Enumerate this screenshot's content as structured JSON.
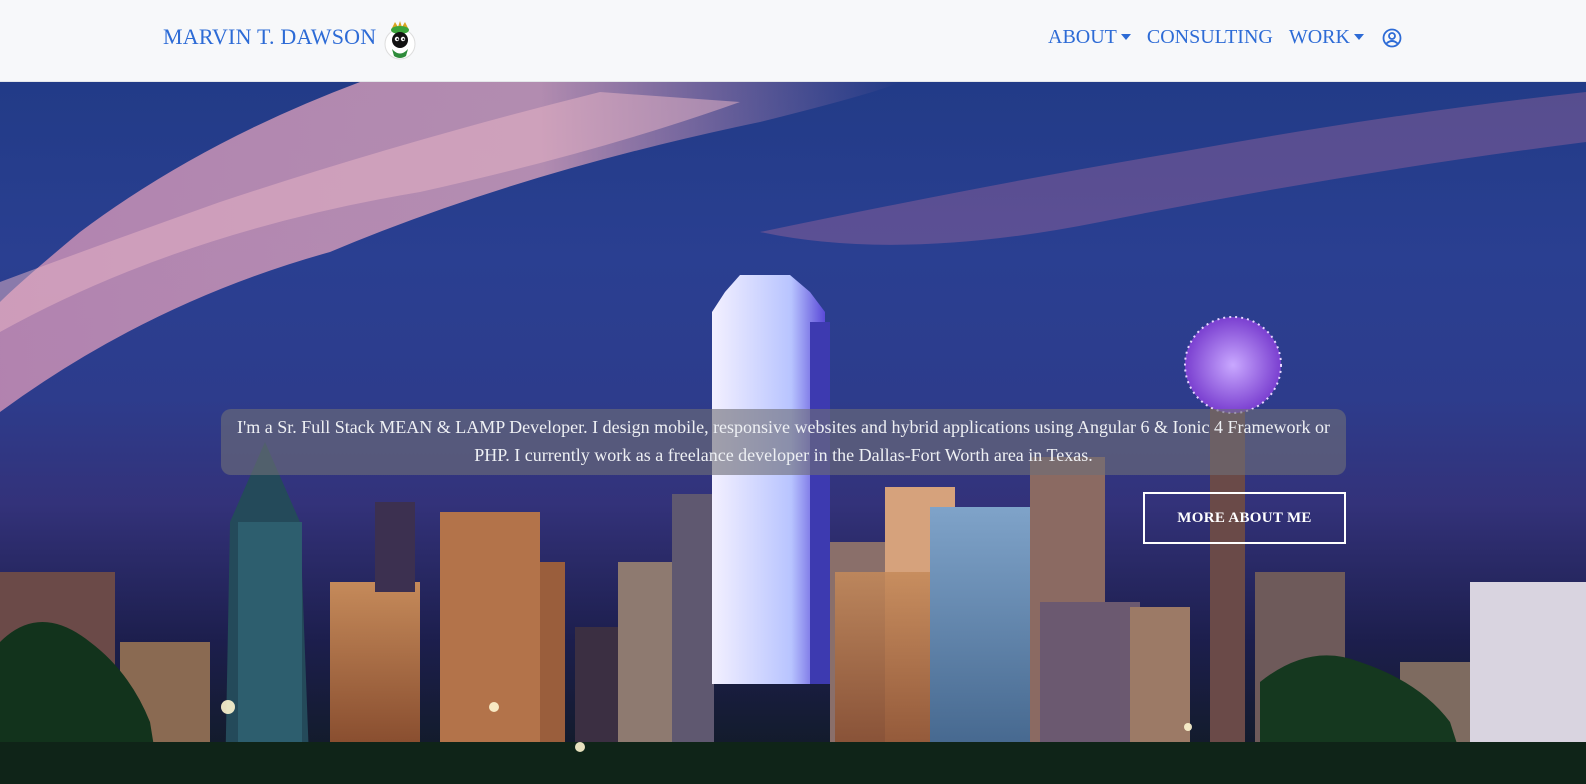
{
  "navbar": {
    "brand": "MARVIN T. DAWSON",
    "logo_icon": "marvin-martian-logo-icon",
    "items": [
      {
        "label": "ABOUT",
        "has_dropdown": true
      },
      {
        "label": "CONSULTING",
        "has_dropdown": false
      },
      {
        "label": "WORK",
        "has_dropdown": true
      }
    ],
    "account_icon": "user-circle-icon",
    "link_color": "#2d6bd6"
  },
  "hero": {
    "background": "dallas-skyline-night-photo",
    "intro": "I'm a Sr. Full Stack MEAN & LAMP Developer. I design mobile, responsive websites and hybrid applications using Angular 6 & Ionic 4 Framework or PHP. I currently work as a freelance developer in the Dallas-Fort Worth area in Texas.",
    "cta_label": "MORE ABOUT ME"
  }
}
